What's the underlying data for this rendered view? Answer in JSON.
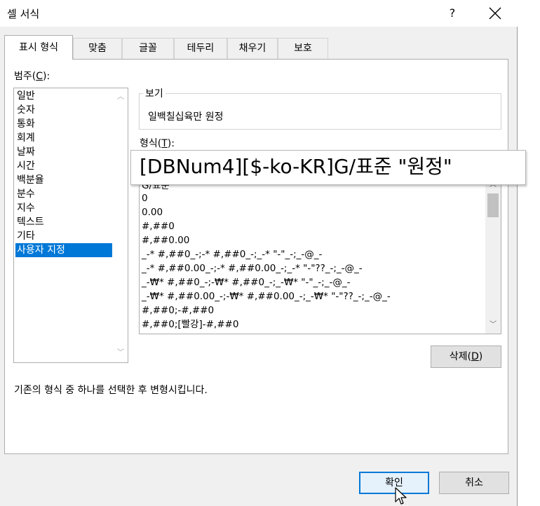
{
  "window": {
    "title": "셀 서식",
    "help_label": "?"
  },
  "tabs": [
    {
      "label": "표시 형식",
      "active": true
    },
    {
      "label": "맞춤"
    },
    {
      "label": "글꼴"
    },
    {
      "label": "테두리"
    },
    {
      "label": "채우기"
    },
    {
      "label": "보호"
    }
  ],
  "category": {
    "label_text": "범주(",
    "label_key": "C",
    "label_end": "):",
    "items": [
      "일반",
      "숫자",
      "통화",
      "회계",
      "날짜",
      "시간",
      "백분율",
      "분수",
      "지수",
      "텍스트",
      "기타",
      "사용자 지정"
    ],
    "selected": "사용자 지정"
  },
  "sample": {
    "legend": "보기",
    "value": "일백칠십육만 원정"
  },
  "format": {
    "label_text": "형식(",
    "label_key": "T",
    "label_end": "):",
    "value": "[DBNum4][$-ko-KR]G/표준 \"원정\"",
    "list_partial": "G/표준",
    "list": [
      "0",
      "0.00",
      "#,##0",
      "#,##0.00",
      "_-* #,##0_-;-* #,##0_-;_-* \"-\"_-;_-@_-",
      "_-* #,##0.00_-;-* #,##0.00_-;_-* \"-\"??_-;_-@_-",
      "_-₩* #,##0_-;-₩* #,##0_-;_-₩* \"-\"_-;_-@_-",
      "_-₩* #,##0.00_-;-₩* #,##0.00_-;_-₩* \"-\"??_-;_-@_-",
      "#,##0;-#,##0",
      "#,##0;[빨강]-#,##0"
    ]
  },
  "delete_button": {
    "text": "삭제(",
    "key": "D",
    "end": ")"
  },
  "description": "기존의 형식 중 하나를 선택한 후 변형시킵니다.",
  "ok_label": "확인",
  "cancel_label": "취소",
  "colors": {
    "selection": "#0078d7",
    "dialog_bg": "#f0f0f0"
  }
}
